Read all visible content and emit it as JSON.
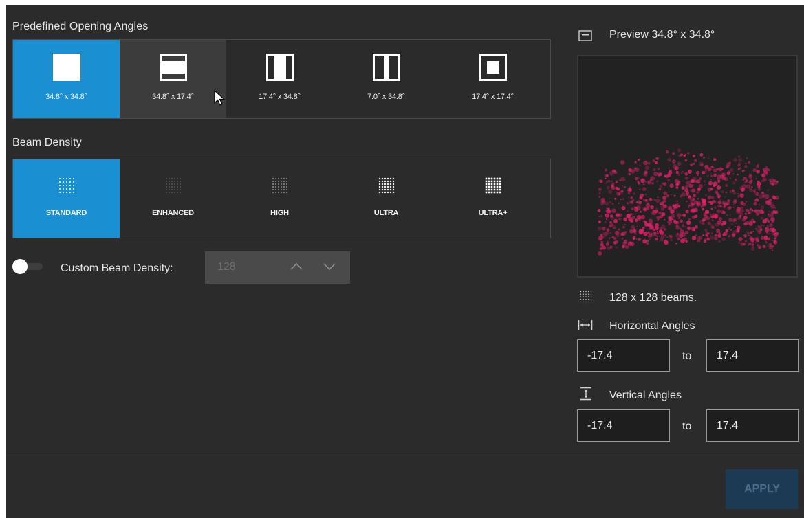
{
  "opening_angles": {
    "title": "Predefined Opening Angles",
    "options": [
      {
        "label": "34.8° x 34.8°",
        "icon": "square-full-icon",
        "state": "selected"
      },
      {
        "label": "34.8° x 17.4°",
        "icon": "horizontal-band-icon",
        "state": "hover"
      },
      {
        "label": "17.4° x 34.8°",
        "icon": "vertical-band-icon",
        "state": "normal"
      },
      {
        "label": "7.0° x 34.8°",
        "icon": "narrow-vertical-band-icon",
        "state": "normal"
      },
      {
        "label": "17.4° x 17.4°",
        "icon": "center-square-icon",
        "state": "normal"
      }
    ]
  },
  "beam_density": {
    "title": "Beam Density",
    "options": [
      {
        "label": "STANDARD",
        "state": "selected"
      },
      {
        "label": "ENHANCED",
        "state": "normal"
      },
      {
        "label": "HIGH",
        "state": "normal"
      },
      {
        "label": "ULTRA",
        "state": "normal"
      },
      {
        "label": "ULTRA+",
        "state": "normal"
      }
    ]
  },
  "custom_density": {
    "label": "Custom Beam Density:",
    "value": "128",
    "enabled": false
  },
  "preview": {
    "title": "Preview 34.8° x 34.8°",
    "beams_text": "128 x 128 beams.",
    "point_color": "#e0206a"
  },
  "horizontal": {
    "title": "Horizontal Angles",
    "from": "-17.4",
    "to_label": "to",
    "to": "17.4"
  },
  "vertical": {
    "title": "Vertical Angles",
    "from": "-17.4",
    "to_label": "to",
    "to": "17.4"
  },
  "apply_label": "APPLY",
  "colors": {
    "accent": "#1a8fd1",
    "panel": "#2b2b2b"
  }
}
